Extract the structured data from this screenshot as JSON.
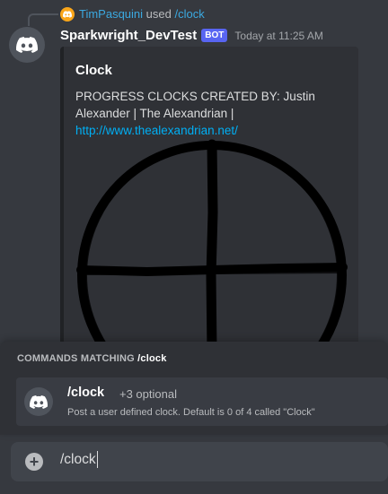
{
  "reply": {
    "user": "TimPasquini",
    "used_text": "used",
    "command": "/clock"
  },
  "message": {
    "author": "Sparkwright_DevTest",
    "bot_tag": "BOT",
    "timestamp": "Today at 11:25 AM"
  },
  "embed": {
    "title": "Clock",
    "description": "PROGRESS CLOCKS CREATED BY: Justin Alexander | The Alexandrian | ",
    "link": "http://www.thealexandrian.net/",
    "image_icon": "progress-clock-image"
  },
  "autocomplete": {
    "header_prefix": "Commands matching",
    "query": "/clock",
    "items": [
      {
        "name": "/clock",
        "optional": "+3 optional",
        "description": "Post a user defined clock. Default is 0 of 4 called \"Clock\""
      }
    ]
  },
  "input": {
    "value": "/clock",
    "add_icon": "plus-icon"
  },
  "colors": {
    "background": "#36393f",
    "embed_bg": "#2f3136",
    "bot_tag": "#5865f2",
    "link": "#00aff4",
    "input_bg": "#40444b"
  }
}
